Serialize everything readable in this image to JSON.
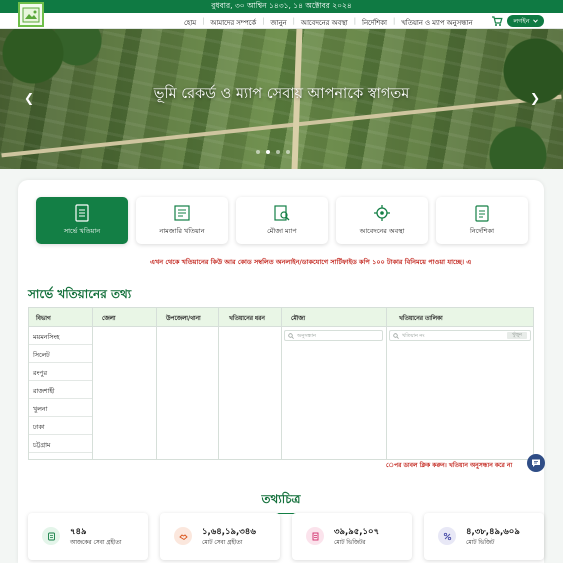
{
  "topbar": {
    "date": "বুধবার, ৩০ আশ্বিন ১৪৩১, ১৪ অক্টোবর ২০২৪"
  },
  "nav": {
    "items": [
      "হোম",
      "আমাদের সম্পর্কে",
      "জানুন",
      "আবেদনের অবস্থা",
      "নির্দেশিকা",
      "খতিয়ান ও ম্যাপ অনুসন্ধান"
    ],
    "login_label": "লগইন"
  },
  "hero": {
    "title": "ভূমি রেকর্ড ও ম্যাপ সেবায় আপনাকে স্বাগতম"
  },
  "tabs": [
    "সার্ভে খতিয়ান",
    "নামজারি খতিয়ান",
    "মৌজা ম্যাপ",
    "আবেদনের অবস্থা",
    "নির্দেশিকা"
  ],
  "notice": "এখন থেকে খতিয়ানের কিউ আর কোড সম্বলিত অনলাইন/ডাকযোগে সার্টিফাইড কপি ১০০ টাকার বিনিময়ে পাওয়া যাচ্ছে। এ",
  "survey": {
    "title": "সার্ভে খতিয়ানের তথ্য",
    "columns": [
      "বিভাগ",
      "জেলা",
      "উপজেলা/থানা",
      "খতিয়ানের ধরন",
      "মৌজা",
      "খতিয়ানের তালিকা"
    ],
    "divisions": [
      "ময়মনসিংহ",
      "সিলেট",
      "রংপুর",
      "রাজশাহী",
      "খুলনা",
      "ঢাকা",
      "চট্টগ্রাম"
    ],
    "mouza_placeholder": "অনুসন্ধান",
    "khatian_placeholder": "খতিয়ান নং",
    "search_button": "খুঁজুন",
    "hint": "েপর ডাবল ক্লিক করুন। খতিয়ান অনুসন্ধান করে না"
  },
  "info": {
    "title": "তথ্যচিত্র",
    "stats": [
      {
        "value": "৭৪৯",
        "label": "আজকের সেবা গ্রহীতা",
        "icon": "user-icon",
        "color": "#e4f5ea"
      },
      {
        "value": "১,৬৪,১৯,৩৪৬",
        "label": "মোট সেবা গ্রহীতা",
        "icon": "handshake-icon",
        "color": "#fbe7dd"
      },
      {
        "value": "৩৯,৯৫,১০৭",
        "label": "মোট ভিজিটর",
        "icon": "document-icon",
        "color": "#fbe3ec"
      },
      {
        "value": "৪,৩৮,৪৯,৬০৯",
        "label": "মোট ভিজিট",
        "icon": "percent-icon",
        "color": "#e8e8f6"
      }
    ]
  },
  "colors": {
    "primary": "#137f45",
    "notice": "#c2231b"
  }
}
